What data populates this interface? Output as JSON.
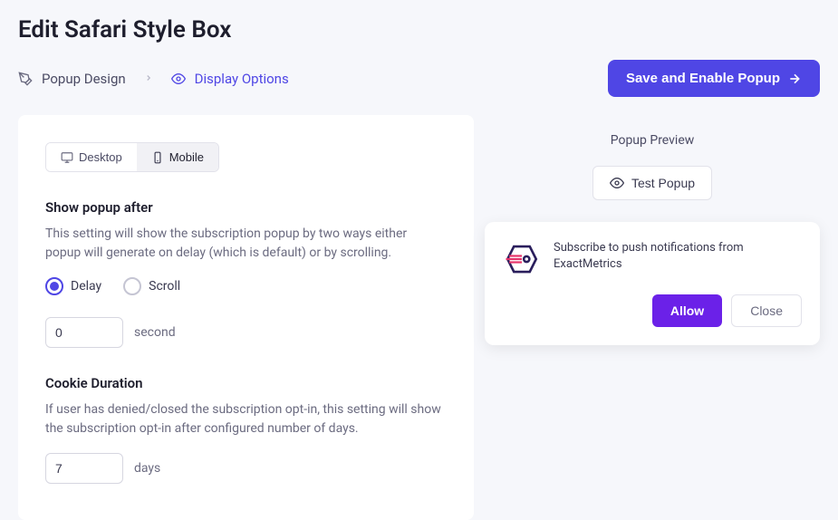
{
  "page_title": "Edit Safari Style Box",
  "breadcrumb": {
    "design_label": "Popup Design",
    "display_label": "Display Options"
  },
  "save_button": "Save and Enable Popup",
  "tabs": {
    "desktop": "Desktop",
    "mobile": "Mobile"
  },
  "show_popup": {
    "title": "Show popup after",
    "description": "This setting will show the subscription popup by two ways either popup will generate on delay (which is default) or by scrolling.",
    "radio_delay": "Delay",
    "radio_scroll": "Scroll",
    "delay_value": "0",
    "delay_unit": "second"
  },
  "cookie": {
    "title": "Cookie Duration",
    "description": "If user has denied/closed the subscription opt-in, this setting will show the subscription opt-in after configured number of days.",
    "value": "7",
    "unit": "days"
  },
  "preview": {
    "title": "Popup Preview",
    "test_button": "Test Popup",
    "message": "Subscribe to push notifications from ExactMetrics",
    "allow": "Allow",
    "close": "Close"
  }
}
